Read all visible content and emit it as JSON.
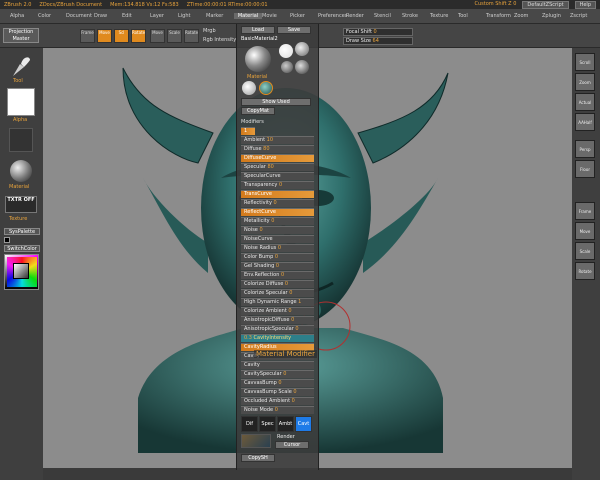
{
  "titlebar": {
    "app": "ZBrush 2.0",
    "doc": "ZDocs/ZBrush Document",
    "mem": "Mem:134.818  Vs:12  Fs:583",
    "time": "ZTime:00:00:01  RTime:00:00:01",
    "custom_label": "Custom  Shift  Z  0",
    "script_btn": "DefaultZScript",
    "help_btn": "Help"
  },
  "menus": [
    "Alpha",
    "Color",
    "Document",
    "Draw",
    "Edit",
    "Layer",
    "Light",
    "Marker",
    "Material",
    "Movie",
    "Picker",
    "Preferences",
    "Render",
    "Stencil",
    "Stroke",
    "Texture",
    "Tool",
    "Transform",
    "Zoom",
    "Zplugin",
    "Zscript"
  ],
  "active_menu": "Material",
  "toolshelf": {
    "projection_master": "Projection Master",
    "buttons": [
      "Frame",
      "Move",
      "Scl",
      "Rotate",
      "Edit",
      "Move",
      "Scale",
      "Rotate"
    ],
    "mrgb": "Mrgb",
    "rgb_intensity": "Rgb Intensity",
    "focal_shift_label": "Focal Shift",
    "focal_shift_value": "0",
    "draw_size_label": "Draw Size",
    "draw_size_value": "64"
  },
  "left": {
    "tool_label": "Tool",
    "alpha_label": "Alpha",
    "material_label": "Material",
    "texture_toggle": "TXTR OFF",
    "texture_label": "Texture",
    "sys_palette": "SysPalette",
    "switch_color": "SwitchColor"
  },
  "right": {
    "buttons": [
      "Scroll",
      "Zoom",
      "Actual",
      "AAHalf",
      "Persp",
      "Floor",
      "Local",
      "XYZ",
      "Frame",
      "Move",
      "Scale",
      "Rotate"
    ]
  },
  "panel": {
    "load": "Load",
    "save": "Save",
    "current_material": "BasicMaterial2",
    "material_label": "Material",
    "show_used": "Show Used",
    "copy_mat": "CopyMat",
    "modifiers_label": "Modifiers",
    "modifiers_value": "1",
    "rows": [
      {
        "label": "Ambient",
        "value": "10"
      },
      {
        "label": "Diffuse",
        "value": "80"
      },
      {
        "label": "DiffuseCurve",
        "value": ""
      },
      {
        "label": "Specular",
        "value": "80"
      },
      {
        "label": "SpecularCurve",
        "value": ""
      },
      {
        "label": "Transparency",
        "value": "0"
      },
      {
        "label": "TransCurve",
        "value": ""
      },
      {
        "label": "Reflectivity",
        "value": "0"
      },
      {
        "label": "ReflectCurve",
        "value": ""
      },
      {
        "label": "Metallicity",
        "value": "0"
      },
      {
        "label": "Noise",
        "value": "0"
      },
      {
        "label": "NoiseCurve",
        "value": ""
      },
      {
        "label": "Noise Radius",
        "value": "0"
      },
      {
        "label": "Color Bump",
        "value": "0"
      },
      {
        "label": "Gel Shading",
        "value": "0"
      },
      {
        "label": "Env.Reflection",
        "value": "0"
      },
      {
        "label": "Colorize Diffuse",
        "value": "0"
      },
      {
        "label": "Colorize Specular",
        "value": "0"
      },
      {
        "label": "High Dynamic Range",
        "value": "1"
      },
      {
        "label": "Colorize Ambient",
        "value": "0"
      },
      {
        "label": "AnisotropicDiffuse",
        "value": "0"
      },
      {
        "label": "AnisotropicSpecular",
        "value": "0"
      },
      {
        "label": "CavityIntensity",
        "value": "0.3"
      },
      {
        "label": "CavityRadius",
        "value": ""
      },
      {
        "label": "Cavity",
        "value": ""
      },
      {
        "label": "Cavity",
        "value": ""
      },
      {
        "label": "CavitySpecular",
        "value": "0"
      },
      {
        "label": "CavvasBump",
        "value": "0"
      },
      {
        "label": "CavvasBump Scale",
        "value": "0"
      },
      {
        "label": "Occluded  Ambient",
        "value": "0"
      },
      {
        "label": "Noise Mode",
        "value": "0"
      }
    ],
    "bottom_tabs": [
      "Dif",
      "Spec",
      "Ambt",
      "Cavt"
    ],
    "render": "Render",
    "cursor": "Cursor",
    "copy_sh": "CopySH"
  },
  "tooltip": "Material Modifier"
}
